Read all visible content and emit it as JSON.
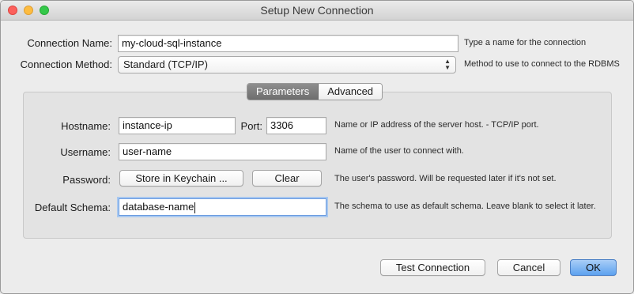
{
  "window": {
    "title": "Setup New Connection"
  },
  "connection": {
    "name_label": "Connection Name:",
    "name_value": "my-cloud-sql-instance",
    "name_hint": "Type a name for the connection",
    "method_label": "Connection Method:",
    "method_value": "Standard (TCP/IP)",
    "method_hint": "Method to use to connect to the RDBMS"
  },
  "tabs": [
    {
      "label": "Parameters",
      "active": true
    },
    {
      "label": "Advanced",
      "active": false
    }
  ],
  "parameters": {
    "hostname_label": "Hostname:",
    "hostname_value": "instance-ip",
    "port_label": "Port:",
    "port_value": "3306",
    "hostname_hint": "Name or IP address of the server host. - TCP/IP port.",
    "username_label": "Username:",
    "username_value": "user-name",
    "username_hint": "Name of the user to connect with.",
    "password_label": "Password:",
    "store_keychain_label": "Store in Keychain ...",
    "clear_label": "Clear",
    "password_hint": "The user's password. Will be requested later if it's not set.",
    "schema_label": "Default Schema:",
    "schema_value": "database-name",
    "schema_hint": "The schema to use as default schema. Leave blank to select it later."
  },
  "footer": {
    "test_label": "Test Connection",
    "cancel_label": "Cancel",
    "ok_label": "OK"
  },
  "colors": {
    "close": "#fc605c",
    "minimize": "#fdbc40",
    "maximize": "#34c84a",
    "primary_button": "#5da2ef",
    "focus_ring": "#6a9be0"
  }
}
